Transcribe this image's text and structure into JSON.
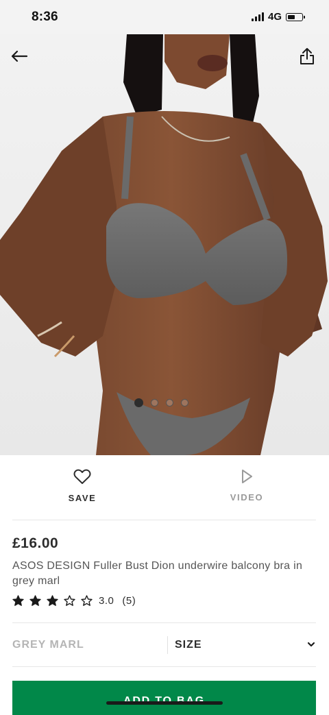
{
  "status_bar": {
    "time": "8:36",
    "network": "4G",
    "battery_level": 0.55
  },
  "hero": {
    "back_icon": "arrow-left-icon",
    "share_icon": "share-icon",
    "image_count": 4,
    "active_image": 1
  },
  "actions": {
    "save": {
      "label": "SAVE",
      "icon": "heart-icon"
    },
    "video": {
      "label": "VIDEO",
      "icon": "play-icon"
    }
  },
  "product": {
    "price": "£16.00",
    "title": "ASOS DESIGN Fuller Bust Dion underwire balcony bra in grey marl",
    "rating": {
      "value": "3.0",
      "count": "(5)",
      "stars_filled": 3,
      "stars_total": 5
    }
  },
  "selectors": {
    "colour": "GREY MARL",
    "size": "SIZE",
    "size_icon": "chevron-down-icon"
  },
  "add_to_bag": {
    "label": "ADD TO BAG",
    "color": "#018849"
  },
  "colors": {
    "accent": "#018849",
    "text": "#2d2d2d",
    "muted": "#9a9a9a"
  }
}
